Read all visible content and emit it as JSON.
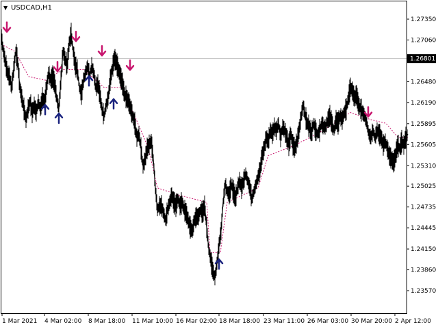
{
  "window": {
    "title": "USDCAD,H1",
    "title_arrow": "▼"
  },
  "chart_data": {
    "type": "line",
    "style": "bar-ohlc-hl",
    "symbol": "USDCAD",
    "timeframe": "H1",
    "ylim": [
      1.2343,
      1.2766
    ],
    "y_ticks": [
      "1.27350",
      "1.27060",
      "1.26770",
      "1.26480",
      "1.26190",
      "1.25895",
      "1.25605",
      "1.25310",
      "1.25025",
      "1.24735",
      "1.24445",
      "1.24150",
      "1.23860",
      "1.23570"
    ],
    "x_ticks": [
      "1 Mar 2021",
      "4 Mar 02:00",
      "8 Mar 18:00",
      "11 Mar 10:00",
      "16 Mar 02:00",
      "18 Mar 18:00",
      "23 Mar 11:00",
      "26 Mar 03:00",
      "30 Mar 20:00",
      "2 Apr 12:00"
    ],
    "current_price": {
      "value": 1.26801,
      "label": "1.26801",
      "line_color": "#c0c0c0"
    },
    "grid": false,
    "colors": {
      "price": "#000000",
      "indicator": "#c8166e",
      "sell_arrow": "#c8166e",
      "buy_arrow": "#1a237e"
    },
    "price_path": [
      [
        0,
        1.271
      ],
      [
        3,
        1.269
      ],
      [
        6,
        1.2675
      ],
      [
        9,
        1.266
      ],
      [
        12,
        1.2655
      ],
      [
        15,
        1.264
      ],
      [
        18,
        1.2665
      ],
      [
        21,
        1.269
      ],
      [
        24,
        1.2675
      ],
      [
        27,
        1.264
      ],
      [
        30,
        1.2625
      ],
      [
        33,
        1.261
      ],
      [
        36,
        1.2595
      ],
      [
        39,
        1.261
      ],
      [
        42,
        1.262
      ],
      [
        45,
        1.2605
      ],
      [
        48,
        1.2615
      ],
      [
        51,
        1.2605
      ],
      [
        54,
        1.262
      ],
      [
        57,
        1.261
      ],
      [
        60,
        1.2625
      ],
      [
        63,
        1.262
      ],
      [
        66,
        1.264
      ],
      [
        69,
        1.266
      ],
      [
        72,
        1.265
      ],
      [
        75,
        1.2655
      ],
      [
        78,
        1.2645
      ],
      [
        81,
        1.2625
      ],
      [
        84,
        1.261
      ],
      [
        87,
        1.265
      ],
      [
        90,
        1.269
      ],
      [
        93,
        1.268
      ],
      [
        96,
        1.267
      ],
      [
        99,
        1.27
      ],
      [
        102,
        1.2715
      ],
      [
        105,
        1.269
      ],
      [
        108,
        1.267
      ],
      [
        111,
        1.2665
      ],
      [
        114,
        1.264
      ],
      [
        117,
        1.263
      ],
      [
        120,
        1.265
      ],
      [
        123,
        1.266
      ],
      [
        126,
        1.267
      ],
      [
        129,
        1.2655
      ],
      [
        132,
        1.267
      ],
      [
        135,
        1.266
      ],
      [
        138,
        1.264
      ],
      [
        141,
        1.2645
      ],
      [
        144,
        1.263
      ],
      [
        147,
        1.261
      ],
      [
        150,
        1.26
      ],
      [
        153,
        1.2615
      ],
      [
        156,
        1.2625
      ],
      [
        159,
        1.265
      ],
      [
        162,
        1.2665
      ],
      [
        165,
        1.268
      ],
      [
        168,
        1.2675
      ],
      [
        171,
        1.2665
      ],
      [
        174,
        1.2655
      ],
      [
        177,
        1.2645
      ],
      [
        180,
        1.263
      ],
      [
        183,
        1.2625
      ],
      [
        186,
        1.262
      ],
      [
        189,
        1.261
      ],
      [
        192,
        1.26
      ],
      [
        195,
        1.259
      ],
      [
        198,
        1.257
      ],
      [
        201,
        1.2575
      ],
      [
        204,
        1.2555
      ],
      [
        207,
        1.253
      ],
      [
        210,
        1.254
      ],
      [
        213,
        1.2555
      ],
      [
        216,
        1.256
      ],
      [
        219,
        1.2565
      ],
      [
        222,
        1.254
      ],
      [
        225,
        1.25
      ],
      [
        228,
        1.247
      ],
      [
        231,
        1.2475
      ],
      [
        234,
        1.2475
      ],
      [
        237,
        1.2465
      ],
      [
        240,
        1.2455
      ],
      [
        243,
        1.247
      ],
      [
        246,
        1.248
      ],
      [
        249,
        1.249
      ],
      [
        252,
        1.248
      ],
      [
        255,
        1.2475
      ],
      [
        258,
        1.2485
      ],
      [
        261,
        1.2475
      ],
      [
        264,
        1.248
      ],
      [
        267,
        1.247
      ],
      [
        270,
        1.2465
      ],
      [
        273,
        1.2455
      ],
      [
        276,
        1.2445
      ],
      [
        279,
        1.244
      ],
      [
        282,
        1.2455
      ],
      [
        285,
        1.246
      ],
      [
        288,
        1.246
      ],
      [
        291,
        1.247
      ],
      [
        294,
        1.2465
      ],
      [
        297,
        1.2475
      ],
      [
        300,
        1.2445
      ],
      [
        303,
        1.2415
      ],
      [
        306,
        1.24
      ],
      [
        309,
        1.2385
      ],
      [
        312,
        1.2375
      ],
      [
        315,
        1.2395
      ],
      [
        318,
        1.242
      ],
      [
        321,
        1.244
      ],
      [
        324,
        1.248
      ],
      [
        327,
        1.2505
      ],
      [
        330,
        1.2495
      ],
      [
        333,
        1.249
      ],
      [
        336,
        1.2505
      ],
      [
        339,
        1.2495
      ],
      [
        342,
        1.2485
      ],
      [
        345,
        1.25
      ],
      [
        348,
        1.251
      ],
      [
        351,
        1.25
      ],
      [
        354,
        1.251
      ],
      [
        357,
        1.252
      ],
      [
        360,
        1.251
      ],
      [
        363,
        1.25
      ],
      [
        366,
        1.2485
      ],
      [
        369,
        1.2495
      ],
      [
        372,
        1.2505
      ],
      [
        375,
        1.2515
      ],
      [
        378,
        1.2525
      ],
      [
        381,
        1.2545
      ],
      [
        384,
        1.2555
      ],
      [
        387,
        1.257
      ],
      [
        390,
        1.2565
      ],
      [
        393,
        1.258
      ],
      [
        396,
        1.2575
      ],
      [
        399,
        1.2585
      ],
      [
        402,
        1.258
      ],
      [
        405,
        1.259
      ],
      [
        408,
        1.257
      ],
      [
        411,
        1.2585
      ],
      [
        414,
        1.258
      ],
      [
        417,
        1.257
      ],
      [
        420,
        1.256
      ],
      [
        423,
        1.2575
      ],
      [
        426,
        1.256
      ],
      [
        429,
        1.2555
      ],
      [
        432,
        1.2565
      ],
      [
        435,
        1.258
      ],
      [
        438,
        1.26
      ],
      [
        441,
        1.2615
      ],
      [
        444,
        1.26
      ],
      [
        447,
        1.259
      ],
      [
        450,
        1.2585
      ],
      [
        453,
        1.2575
      ],
      [
        456,
        1.259
      ],
      [
        459,
        1.258
      ],
      [
        462,
        1.2575
      ],
      [
        465,
        1.258
      ],
      [
        468,
        1.259
      ],
      [
        471,
        1.2585
      ],
      [
        474,
        1.2585
      ],
      [
        477,
        1.2595
      ],
      [
        480,
        1.26
      ],
      [
        483,
        1.259
      ],
      [
        486,
        1.258
      ],
      [
        489,
        1.2595
      ],
      [
        492,
        1.259
      ],
      [
        495,
        1.26
      ],
      [
        498,
        1.2595
      ],
      [
        501,
        1.2605
      ],
      [
        504,
        1.261
      ],
      [
        507,
        1.2625
      ],
      [
        510,
        1.264
      ],
      [
        513,
        1.2635
      ],
      [
        516,
        1.2625
      ],
      [
        519,
        1.263
      ],
      [
        522,
        1.2615
      ],
      [
        525,
        1.261
      ],
      [
        528,
        1.2605
      ],
      [
        531,
        1.26
      ],
      [
        534,
        1.259
      ],
      [
        537,
        1.2575
      ],
      [
        540,
        1.257
      ],
      [
        543,
        1.258
      ],
      [
        546,
        1.257
      ],
      [
        549,
        1.258
      ],
      [
        552,
        1.2575
      ],
      [
        555,
        1.257
      ],
      [
        558,
        1.256
      ],
      [
        561,
        1.2565
      ],
      [
        564,
        1.2555
      ],
      [
        567,
        1.2545
      ],
      [
        570,
        1.254
      ],
      [
        573,
        1.2535
      ],
      [
        576,
        1.2545
      ],
      [
        579,
        1.256
      ],
      [
        582,
        1.2555
      ],
      [
        585,
        1.2565
      ],
      [
        588,
        1.256
      ],
      [
        591,
        1.257
      ],
      [
        594,
        1.2575
      ]
    ],
    "indicator_path": [
      [
        0,
        1.27
      ],
      [
        20,
        1.269
      ],
      [
        40,
        1.2655
      ],
      [
        65,
        1.265
      ],
      [
        90,
        1.2665
      ],
      [
        120,
        1.2665
      ],
      [
        150,
        1.264
      ],
      [
        175,
        1.264
      ],
      [
        195,
        1.26
      ],
      [
        215,
        1.2555
      ],
      [
        228,
        1.25
      ],
      [
        260,
        1.249
      ],
      [
        300,
        1.248
      ],
      [
        305,
        1.241
      ],
      [
        320,
        1.241
      ],
      [
        330,
        1.248
      ],
      [
        375,
        1.25
      ],
      [
        390,
        1.2545
      ],
      [
        430,
        1.256
      ],
      [
        470,
        1.258
      ],
      [
        510,
        1.2605
      ],
      [
        540,
        1.2595
      ],
      [
        562,
        1.259
      ],
      [
        580,
        1.257
      ],
      [
        594,
        1.257
      ]
    ],
    "signals": [
      {
        "type": "sell",
        "x": 8,
        "y": 1.2723
      },
      {
        "type": "sell",
        "x": 82,
        "y": 1.2668
      },
      {
        "type": "sell",
        "x": 109,
        "y": 1.271
      },
      {
        "type": "sell",
        "x": 147,
        "y": 1.269
      },
      {
        "type": "sell",
        "x": 188,
        "y": 1.267
      },
      {
        "type": "sell",
        "x": 536,
        "y": 1.2605
      },
      {
        "type": "buy",
        "x": 64,
        "y": 1.261
      },
      {
        "type": "buy",
        "x": 84,
        "y": 1.2598
      },
      {
        "type": "buy",
        "x": 128,
        "y": 1.265
      },
      {
        "type": "buy",
        "x": 164,
        "y": 1.2618
      },
      {
        "type": "buy",
        "x": 318,
        "y": 1.2395
      }
    ]
  }
}
